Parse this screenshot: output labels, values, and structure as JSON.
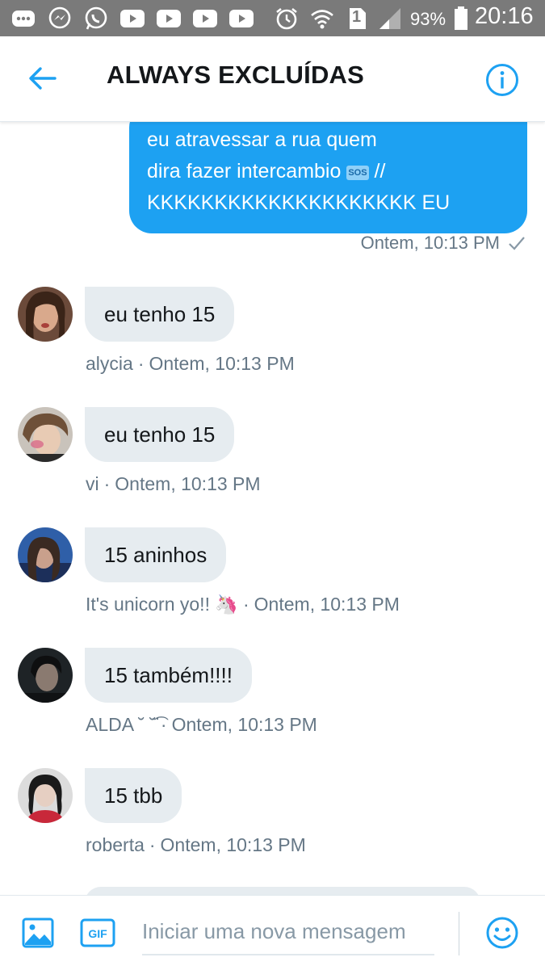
{
  "status_bar": {
    "battery": "93%",
    "time": "20:16",
    "sim_slot": "1",
    "icons": [
      "chat-icon",
      "messenger-icon",
      "whatsapp-icon",
      "youtube-icon",
      "youtube-icon",
      "youtube-icon",
      "youtube-icon",
      "alarm-icon",
      "wifi-icon",
      "sim-icon",
      "signal-icon",
      "battery-icon"
    ]
  },
  "header": {
    "title": "ALWAYS EXCLUÍDAS",
    "back_icon": "back-arrow-icon",
    "info_icon": "info-icon"
  },
  "sent_message": {
    "lines": [
      "eu atravessar a rua quem",
      "dira fazer intercambio",
      "KKKKKKKKKKKKKKKKKKKK EU"
    ],
    "emoji": "SOS",
    "line2_suffix": " //",
    "meta": "Ontem, 10:13 PM"
  },
  "messages": [
    {
      "text": "eu tenho 15",
      "sender": "alycia",
      "time": "Ontem, 10:13 PM"
    },
    {
      "text": "eu tenho 15",
      "sender": "vi",
      "time": "Ontem, 10:13 PM"
    },
    {
      "text": "15 aninhos",
      "sender": "It's unicorn yo!! 🦄",
      "time": "Ontem, 10:13 PM"
    },
    {
      "text": "15 também!!!!",
      "sender": "ALDA ˘ ˘̈͡",
      "time": "Ontem, 10:13 PM"
    },
    {
      "text": "15 tbb",
      "sender": "roberta",
      "time": "Ontem, 10:13 PM"
    }
  ],
  "separator": "·",
  "composer": {
    "placeholder": "Iniciar uma nova mensagem",
    "gif_label": "GIF",
    "image_icon": "image-icon",
    "emoji_icon": "emoji-icon"
  },
  "colors": {
    "accent": "#1da1f2",
    "status_bar": "#7a7a7a",
    "received_bubble": "#e6ecf0",
    "meta_text": "#657786"
  }
}
